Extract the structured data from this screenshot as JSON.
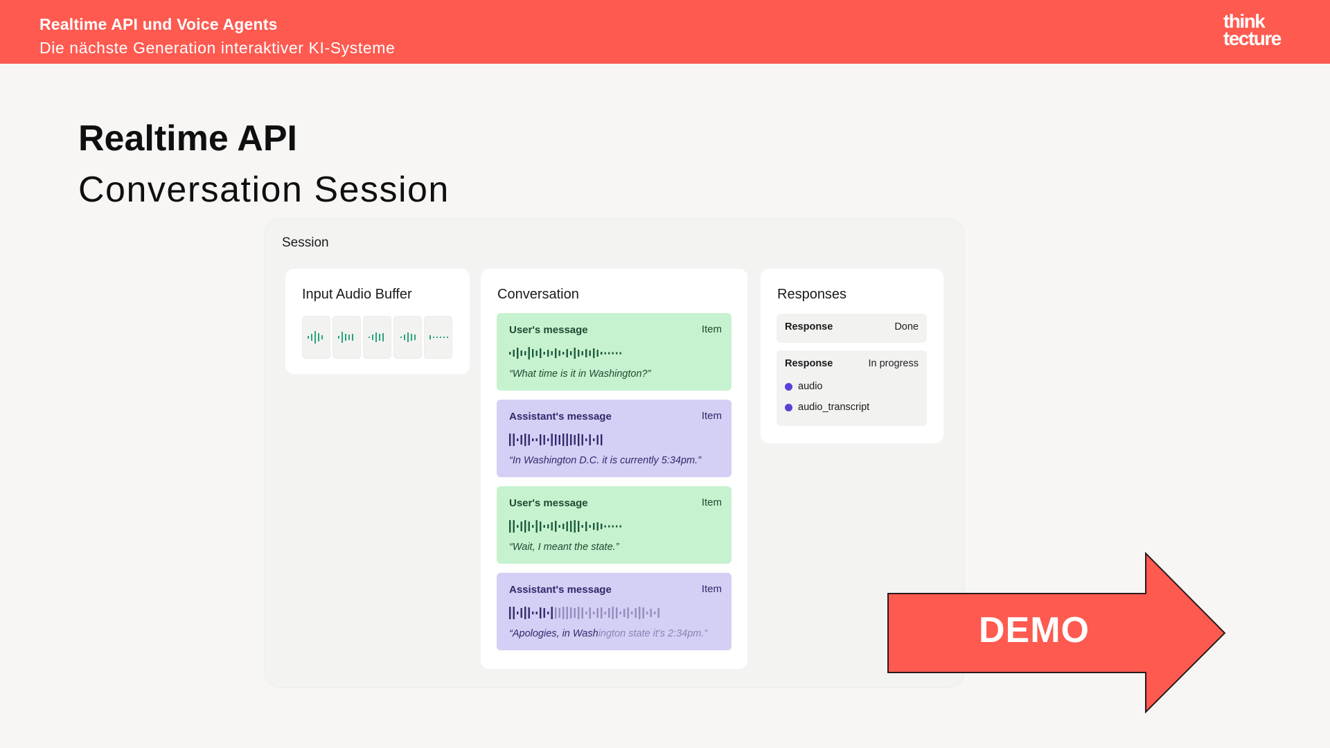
{
  "header": {
    "title": "Realtime API und Voice Agents",
    "subtitle": "Die nächste Generation interaktiver KI-Systeme",
    "logo_line1": "think",
    "logo_line2": "tecture"
  },
  "slide": {
    "title": "Realtime API",
    "subtitle": "Conversation Session"
  },
  "session": {
    "title": "Session",
    "input_buffer": {
      "title": "Input Audio Buffer",
      "chunk_count": 5
    },
    "conversation": {
      "title": "Conversation",
      "messages": [
        {
          "role": "User's message",
          "tag": "Item",
          "quote": "“What time is it in Washington?”",
          "type": "user"
        },
        {
          "role": "Assistant's message",
          "tag": "Item",
          "quote": "“In Washington D.C. it is currently 5:34pm.”",
          "type": "assistant"
        },
        {
          "role": "User's message",
          "tag": "Item",
          "quote": "“Wait, I meant the state.”",
          "type": "user"
        },
        {
          "role": "Assistant's message",
          "tag": "Item",
          "quote_spoken": "“Apologies, in Wash",
          "quote_pending": "ington state it's 2:34pm.”",
          "type": "assistant"
        }
      ]
    },
    "responses": {
      "title": "Responses",
      "items": [
        {
          "label": "Response",
          "status": "Done"
        },
        {
          "label": "Response",
          "status": "In progress",
          "parts": [
            "audio",
            "audio_transcript"
          ]
        }
      ]
    }
  },
  "demo_label": "DEMO",
  "colors": {
    "brand": "#fe5a50",
    "user_message_bg": "#c7f2cf",
    "assistant_message_bg": "#d4cff4",
    "part_dot": "#5b3fd6"
  }
}
